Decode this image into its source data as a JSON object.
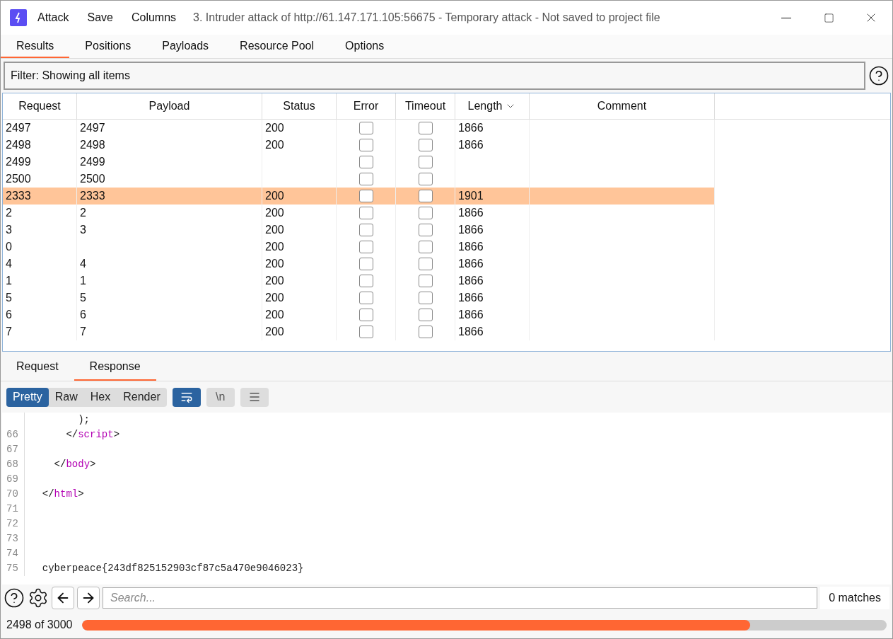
{
  "title_bar": {
    "menu": [
      "Attack",
      "Save",
      "Columns"
    ],
    "title": "3. Intruder attack of http://61.147.171.105:56675 - Temporary attack - Not saved to project file"
  },
  "tabs": [
    {
      "label": "Results",
      "selected": true
    },
    {
      "label": "Positions",
      "selected": false
    },
    {
      "label": "Payloads",
      "selected": false
    },
    {
      "label": "Resource Pool",
      "selected": false
    },
    {
      "label": "Options",
      "selected": false
    }
  ],
  "filter": {
    "value": "Filter: Showing all items"
  },
  "table": {
    "columns": [
      {
        "label": "Request",
        "sorted": false
      },
      {
        "label": "Payload",
        "sorted": false
      },
      {
        "label": "Status",
        "sorted": false
      },
      {
        "label": "Error",
        "sorted": false
      },
      {
        "label": "Timeout",
        "sorted": false
      },
      {
        "label": "Length",
        "sorted": true
      },
      {
        "label": "Comment",
        "sorted": false
      }
    ],
    "rows": [
      {
        "request": "2497",
        "payload": "2497",
        "status": "200",
        "error": false,
        "timeout": false,
        "length": "1866",
        "selected": false
      },
      {
        "request": "2498",
        "payload": "2498",
        "status": "200",
        "error": false,
        "timeout": false,
        "length": "1866",
        "selected": false
      },
      {
        "request": "2499",
        "payload": "2499",
        "status": "",
        "error": false,
        "timeout": false,
        "length": "",
        "selected": false
      },
      {
        "request": "2500",
        "payload": "2500",
        "status": "",
        "error": false,
        "timeout": false,
        "length": "",
        "selected": false
      },
      {
        "request": "2333",
        "payload": "2333",
        "status": "200",
        "error": false,
        "timeout": false,
        "length": "1901",
        "selected": true
      },
      {
        "request": "2",
        "payload": "2",
        "status": "200",
        "error": false,
        "timeout": false,
        "length": "1866",
        "selected": false
      },
      {
        "request": "3",
        "payload": "3",
        "status": "200",
        "error": false,
        "timeout": false,
        "length": "1866",
        "selected": false
      },
      {
        "request": "0",
        "payload": "",
        "status": "200",
        "error": false,
        "timeout": false,
        "length": "1866",
        "selected": false
      },
      {
        "request": "4",
        "payload": "4",
        "status": "200",
        "error": false,
        "timeout": false,
        "length": "1866",
        "selected": false
      },
      {
        "request": "1",
        "payload": "1",
        "status": "200",
        "error": false,
        "timeout": false,
        "length": "1866",
        "selected": false
      },
      {
        "request": "5",
        "payload": "5",
        "status": "200",
        "error": false,
        "timeout": false,
        "length": "1866",
        "selected": false
      },
      {
        "request": "6",
        "payload": "6",
        "status": "200",
        "error": false,
        "timeout": false,
        "length": "1866",
        "selected": false
      },
      {
        "request": "7",
        "payload": "7",
        "status": "200",
        "error": false,
        "timeout": false,
        "length": "1866",
        "selected": false
      }
    ]
  },
  "message_tabs": [
    {
      "label": "Request",
      "selected": false
    },
    {
      "label": "Response",
      "selected": true
    }
  ],
  "view_modes": [
    {
      "label": "Pretty",
      "selected": true
    },
    {
      "label": "Raw",
      "selected": false
    },
    {
      "label": "Hex",
      "selected": false
    },
    {
      "label": "Render",
      "selected": false
    }
  ],
  "toolbar": {
    "wrap_on": true,
    "newline_label": "\\n",
    "newline_on": false
  },
  "code": [
    {
      "segments": [
        {
          "kind": "punct",
          "text": "        );"
        }
      ]
    },
    {
      "number": "66",
      "segments": [
        {
          "kind": "punct",
          "text": "      </"
        },
        {
          "kind": "tag",
          "text": "script"
        },
        {
          "kind": "punct",
          "text": ">"
        }
      ]
    },
    {
      "number": "67"
    },
    {
      "number": "68",
      "segments": [
        {
          "kind": "punct",
          "text": "    </"
        },
        {
          "kind": "tag",
          "text": "body"
        },
        {
          "kind": "punct",
          "text": ">"
        }
      ]
    },
    {
      "number": "69"
    },
    {
      "number": "70",
      "segments": [
        {
          "kind": "punct",
          "text": "  </"
        },
        {
          "kind": "tag",
          "text": "html"
        },
        {
          "kind": "punct",
          "text": ">"
        }
      ]
    },
    {
      "number": "71"
    },
    {
      "number": "72"
    },
    {
      "number": "73"
    },
    {
      "number": "74"
    },
    {
      "number": "75",
      "segments": [
        {
          "kind": "punct",
          "text": "  cyberpeace{243df825152903cf87c5a470e9046023}"
        }
      ]
    }
  ],
  "search": {
    "placeholder": "Search...",
    "matches": "0 matches"
  },
  "status": {
    "text": "2498 of 3000",
    "level": 0.83
  }
}
